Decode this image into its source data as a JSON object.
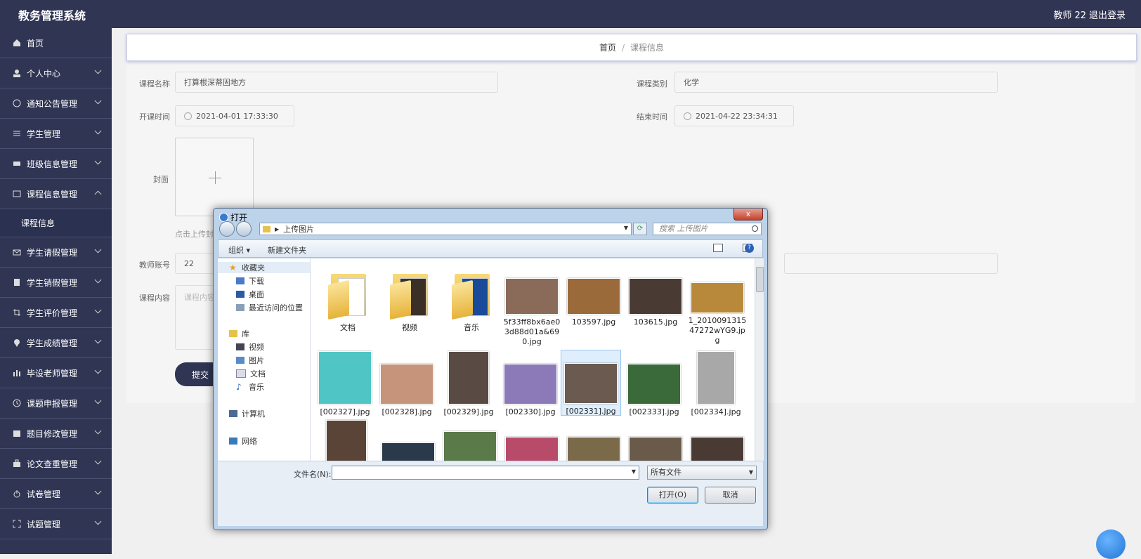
{
  "app": {
    "title": "教务管理系统",
    "user": "教师 22",
    "logout": "退出登录"
  },
  "sidebar": {
    "items": [
      {
        "label": "首页",
        "icon": "home-icon"
      },
      {
        "label": "个人中心",
        "icon": "user-icon"
      },
      {
        "label": "通知公告管理",
        "icon": "compass-icon"
      },
      {
        "label": "学生管理",
        "icon": "sliders-icon"
      },
      {
        "label": "班级信息管理",
        "icon": "ticket-icon"
      },
      {
        "label": "课程信息管理",
        "icon": "card-icon"
      },
      {
        "label": "学生请假管理",
        "icon": "mail-icon"
      },
      {
        "label": "学生销假管理",
        "icon": "clipboard-icon"
      },
      {
        "label": "学生评价管理",
        "icon": "crop-icon"
      },
      {
        "label": "学生成绩管理",
        "icon": "pin-icon"
      },
      {
        "label": "毕设老师管理",
        "icon": "chart-icon"
      },
      {
        "label": "课题申报管理",
        "icon": "clock-icon"
      },
      {
        "label": "题目修改管理",
        "icon": "box-icon"
      },
      {
        "label": "论文查重管理",
        "icon": "bag-icon"
      },
      {
        "label": "试卷管理",
        "icon": "power-icon"
      },
      {
        "label": "试题管理",
        "icon": "frame-icon"
      }
    ],
    "sub_item": "课程信息"
  },
  "breadcrumb": {
    "home": "首页",
    "sep": "/",
    "current": "课程信息"
  },
  "form": {
    "course_name_label": "课程名称",
    "course_name": "打算根深蒂固地方",
    "course_type_label": "课程类别",
    "course_type": "化学",
    "start_label": "开课时间",
    "start_time": "2021-04-01 17:33:30",
    "end_label": "结束时间",
    "end_time": "2021-04-22 23:34:31",
    "cover_label": "封面",
    "upload_hint": "点击上传封",
    "teacher_label": "教师账号",
    "teacher_value": "22",
    "content_label": "课程内容",
    "content_placeholder": "课程内容",
    "submit": "提交"
  },
  "dialog": {
    "title": "打开",
    "close": "x",
    "path": "上传图片",
    "search_placeholder": "搜索 上传图片",
    "toolbar": {
      "organize": "组织 ▾",
      "new_folder": "新建文件夹",
      "help": "?"
    },
    "nav": {
      "favorites": "收藏夹",
      "downloads": "下载",
      "desktop": "桌面",
      "recent": "最近访问的位置",
      "libraries": "库",
      "videos": "视频",
      "pictures": "图片",
      "documents": "文档",
      "music": "音乐",
      "computer": "计算机",
      "network": "网络"
    },
    "files": [
      {
        "name": "文档",
        "kind": "folder"
      },
      {
        "name": "视频",
        "kind": "folder"
      },
      {
        "name": "音乐",
        "kind": "folder"
      },
      {
        "name": "5f33ff8bx6ae03d88d01a&690.jpg",
        "kind": "image",
        "color": "#8a6a58"
      },
      {
        "name": "103597.jpg",
        "kind": "image",
        "color": "#9a6a3a"
      },
      {
        "name": "103615.jpg",
        "kind": "image",
        "color": "#4a3a34"
      },
      {
        "name": "1_201009131547272wYG9.jpg",
        "kind": "image",
        "color": "#b8893a"
      },
      {
        "name": "[002327].jpg",
        "kind": "image",
        "color": "#4fc5c6"
      },
      {
        "name": "[002328].jpg",
        "kind": "image",
        "color": "#c5947a"
      },
      {
        "name": "[002329].jpg",
        "kind": "image",
        "color": "#5a4a44"
      },
      {
        "name": "[002330].jpg",
        "kind": "image",
        "color": "#8c7ab8"
      },
      {
        "name": "[002331].jpg",
        "kind": "image",
        "color": "#6a5a50"
      },
      {
        "name": "[002333].jpg",
        "kind": "image",
        "color": "#3a6a3a"
      },
      {
        "name": "[002334].jpg",
        "kind": "image",
        "color": "#a8a8a8"
      }
    ],
    "filename_label": "文件名(N):",
    "filetype": "所有文件",
    "open": "打开(O)",
    "cancel": "取消"
  }
}
